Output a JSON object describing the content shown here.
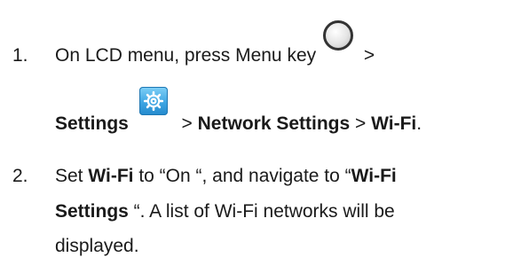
{
  "steps": [
    {
      "number": "1.",
      "line1": {
        "text": "On LCD menu, press Menu key",
        "separator": ">"
      },
      "line2": {
        "bold1": "Settings",
        "sep1": ">",
        "bold2": "Network Settings",
        "sep2": ">",
        "bold3": "Wi-Fi",
        "end": "."
      },
      "icons": {
        "menu_key": "round-menu-key-icon",
        "settings": "settings-gear-icon"
      }
    },
    {
      "number": "2.",
      "line1": {
        "t1": "Set ",
        "b1": "Wi-Fi",
        "t2": " to “On “, and navigate to “",
        "b2": "Wi-Fi"
      },
      "line2": {
        "b1": "Settings",
        "t1": " “. A list of Wi-Fi networks will be"
      },
      "line3": {
        "t1": "displayed."
      }
    }
  ],
  "colors": {
    "text": "#1a1a1a",
    "settings_icon_blue": "#3ea6e3"
  }
}
